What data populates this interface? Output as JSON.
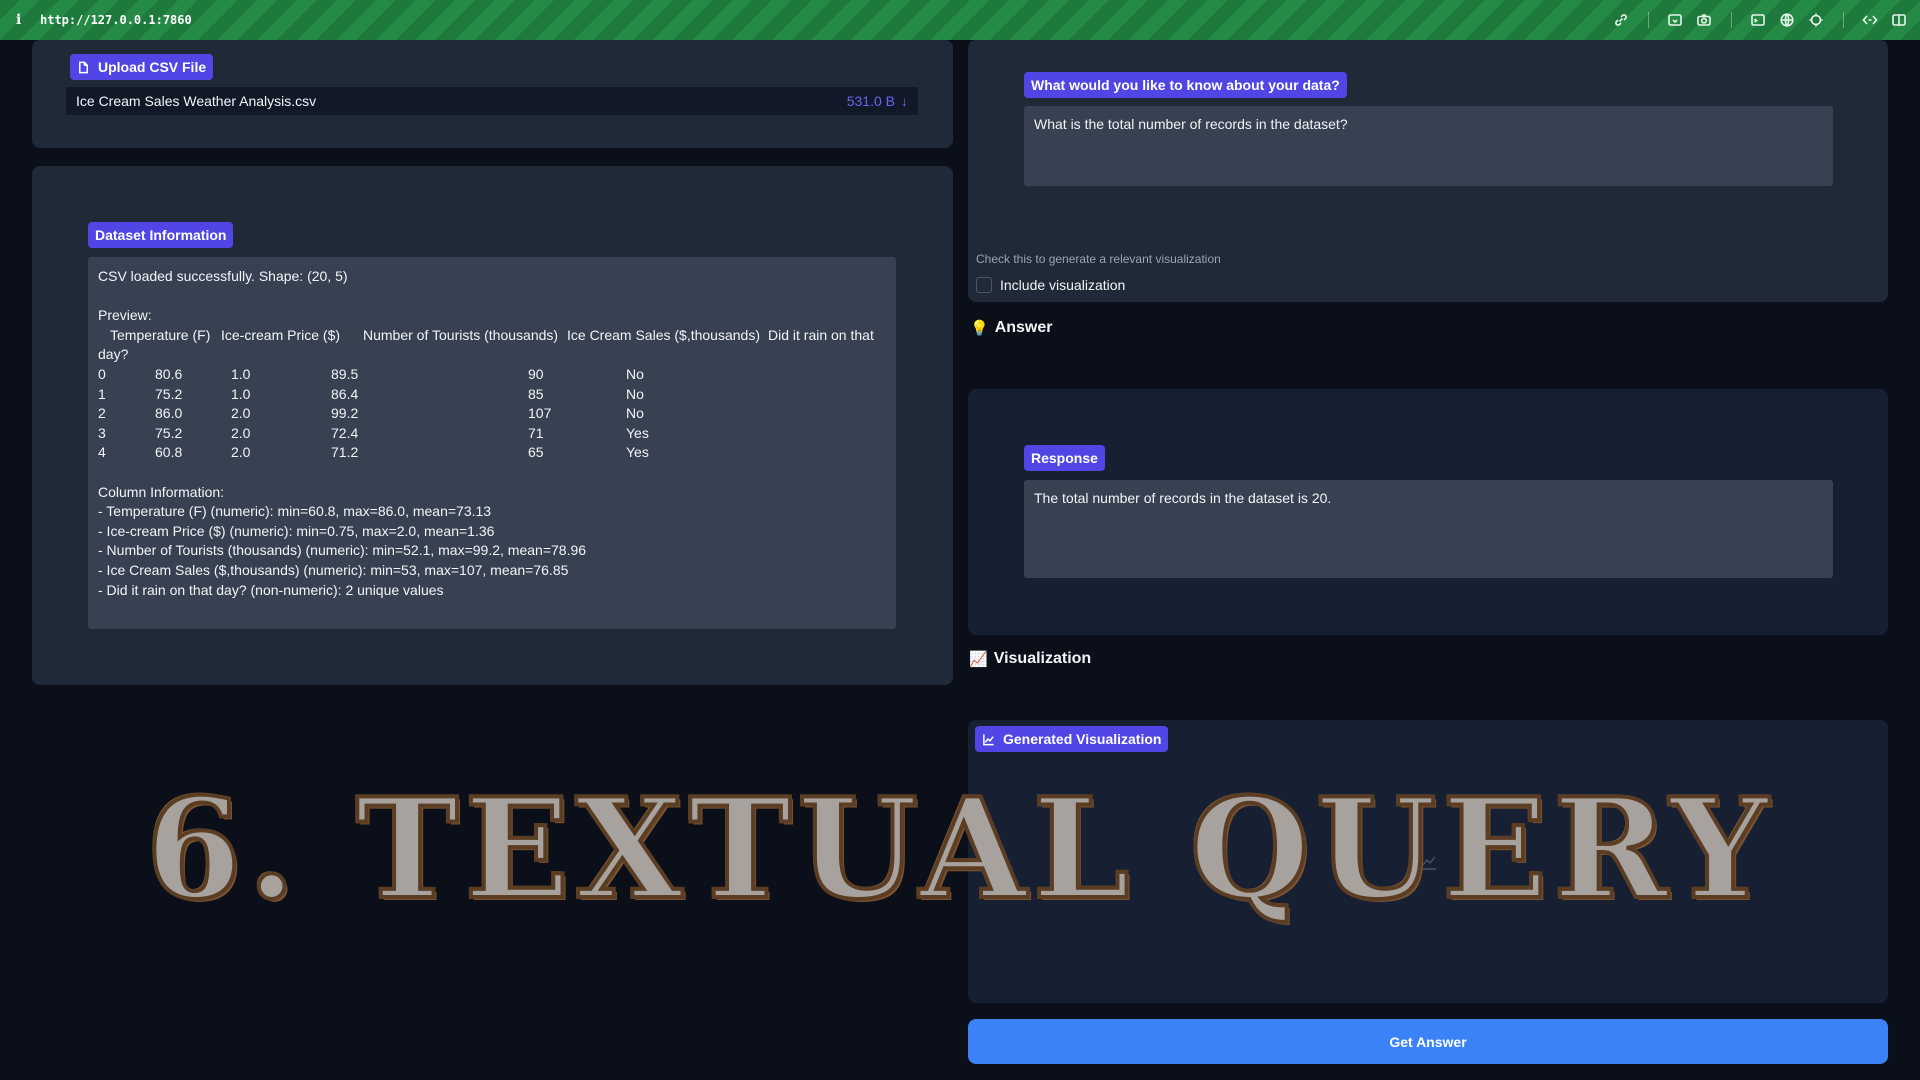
{
  "browser": {
    "url": "http://127.0.0.1:7860",
    "tool_icons": [
      "link-icon",
      "screenshot-icon",
      "camera-icon",
      "terminal-icon",
      "globe-icon",
      "crosshair-icon",
      "extension-icon",
      "sidebar-icon"
    ]
  },
  "upload": {
    "label": "Upload CSV File",
    "file_name": "Ice Cream Sales Weather Analysis.csv",
    "file_size": "531.0 B",
    "download_glyph": "↓"
  },
  "dataset_info": {
    "label": "Dataset Information",
    "status": "CSV loaded successfully. Shape: (20, 5)",
    "preview_title": "Preview:",
    "headers": [
      "Temperature (F)",
      "Ice-cream Price ($)",
      "Number of Tourists (thousands)",
      "Ice Cream Sales ($,thousands)",
      "Did it rain on that"
    ],
    "header_wrap": "day?",
    "rows": [
      [
        "0",
        "80.6",
        "1.0",
        "89.5",
        "90",
        "No"
      ],
      [
        "1",
        "75.2",
        "1.0",
        "86.4",
        "85",
        "No"
      ],
      [
        "2",
        "86.0",
        "2.0",
        "99.2",
        "107",
        "No"
      ],
      [
        "3",
        "75.2",
        "2.0",
        "72.4",
        "71",
        "Yes"
      ],
      [
        "4",
        "60.8",
        "2.0",
        "71.2",
        "65",
        "Yes"
      ]
    ],
    "column_info_title": "Column Information:",
    "column_info": [
      "- Temperature (F) (numeric): min=60.8, max=86.0, mean=73.13",
      "- Ice-cream Price ($) (numeric): min=0.75, max=2.0, mean=1.36",
      "- Number of Tourists (thousands) (numeric): min=52.1, max=99.2, mean=78.96",
      "- Ice Cream Sales ($,thousands) (numeric): min=53, max=107, mean=76.85",
      "- Did it rain on that day? (non-numeric): 2 unique values"
    ]
  },
  "query": {
    "label": "What would you like to know about your data?",
    "value": "What is the total number of records in the dataset?"
  },
  "visualization_toggle": {
    "hint": "Check this to generate a relevant visualization",
    "label": "Include visualization",
    "checked": false
  },
  "answer": {
    "emoji": "💡",
    "title": "Answer",
    "response_label": "Response",
    "response_text": "The total number of records in the dataset is 20."
  },
  "visualization": {
    "emoji": "📈",
    "title": "Visualization",
    "generated_label": "Generated Visualization"
  },
  "get_answer_button": "Get Answer",
  "overlay_title": "6. TEXTUAL QUERY"
}
